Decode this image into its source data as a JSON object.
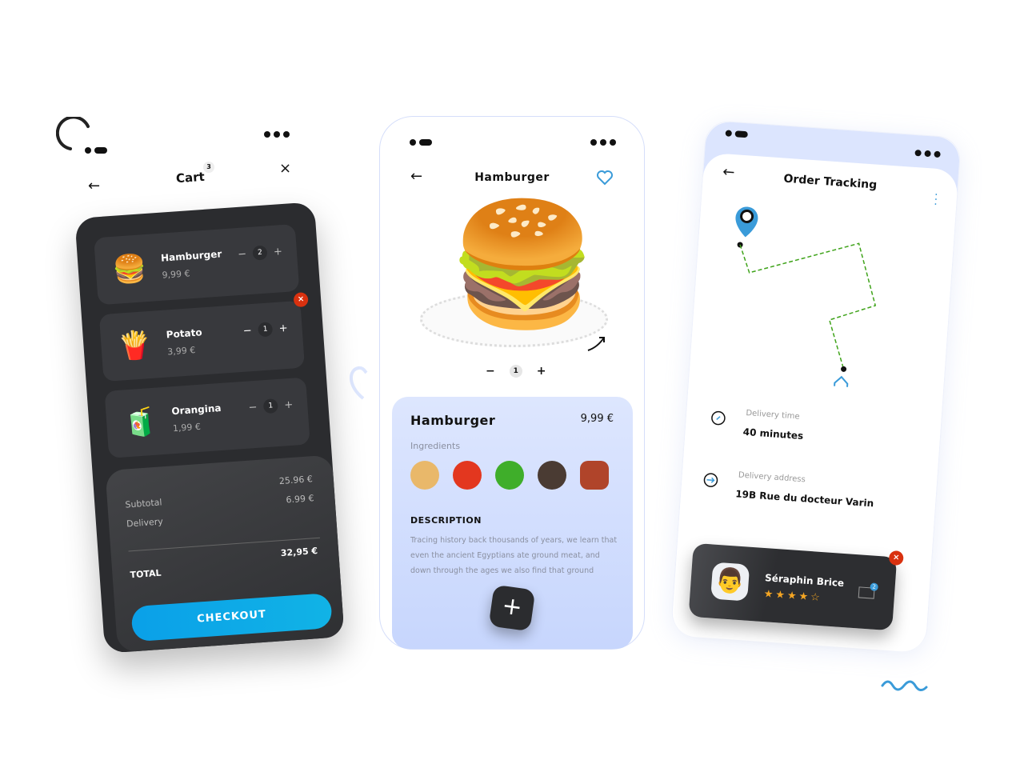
{
  "cart": {
    "title": "Cart",
    "badge": "3",
    "items": [
      {
        "name": "Hamburger",
        "price": "9,99 €",
        "qty": "2",
        "minus": "−",
        "plus": "+"
      },
      {
        "name": "Potato",
        "price": "3,99 €",
        "qty": "1",
        "minus": "−",
        "plus": "+"
      },
      {
        "name": "Orangina",
        "price": "1,99 €",
        "qty": "1",
        "minus": "−",
        "plus": "+"
      }
    ],
    "remove": "×",
    "close": "×",
    "back": "←",
    "subtotal_label": "Subtotal",
    "subtotal": "25.96 €",
    "delivery_label": "Delivery",
    "delivery": "6.99 €",
    "total_label": "TOTAL",
    "total": "32,95 €",
    "checkout": "CHECKOUT"
  },
  "detail": {
    "title": "Hamburger",
    "back": "←",
    "qty": "1",
    "minus": "−",
    "plus": "+",
    "name": "Hamburger",
    "price": "9,99 €",
    "ingredients_label": "Ingredients",
    "ingredients": [
      "bun",
      "tomato",
      "lettuce",
      "patty",
      "bacon"
    ],
    "description_label": "DESCRIPTION",
    "description": "Tracing history back thousands of years, we learn that even the ancient Egyptians ate ground meat, and down through the ages we also find that ground",
    "add": "+"
  },
  "tracking": {
    "title": "Order Tracking",
    "back": "←",
    "delivery_time_label": "Delivery time",
    "delivery_time": "40 minutes",
    "address_label": "Delivery address",
    "address": "19B Rue du docteur Varin",
    "driver": {
      "name": "Séraphin Brice",
      "rating": 4.5,
      "stars": "★★★★☆",
      "messages": "2",
      "close": "×"
    }
  },
  "colors": {
    "accent": "#0aa0e8",
    "dark": "#2b2c2f",
    "panel": "#dce5fe",
    "remove": "#d9310f",
    "route": "#3fa31a"
  }
}
